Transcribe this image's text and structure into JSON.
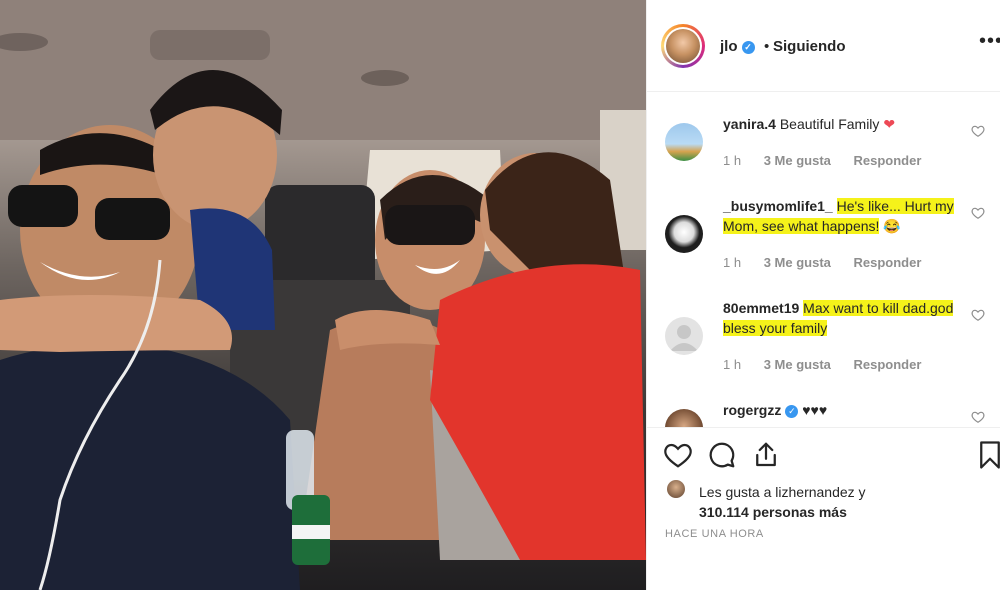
{
  "post": {
    "username": "jlo",
    "verified": true,
    "separator": "•",
    "follow_status": "Siguiendo",
    "more_icon": "more-options-icon"
  },
  "comments": [
    {
      "username": "yanira.4",
      "text": "Beautiful Family",
      "emoji": "❤",
      "highlight": false,
      "time": "1 h",
      "likes": "3 Me gusta",
      "reply": "Responder"
    },
    {
      "username": "_busymomlife1_",
      "text_highlight": "He's like... Hurt my Mom, see what happens!",
      "emoji": "😂",
      "time": "1 h",
      "likes": "3 Me gusta",
      "reply": "Responder"
    },
    {
      "username": "80emmet19",
      "text_highlight": "Max want to kill dad.god bless your family",
      "time": "1 h",
      "likes": "3 Me gusta",
      "reply": "Responder"
    },
    {
      "username": "rogergzz",
      "verified": true,
      "text": "♥♥♥"
    }
  ],
  "actions": {
    "like_icon": "heart-icon",
    "comment_icon": "comment-icon",
    "share_icon": "share-icon",
    "save_icon": "bookmark-icon"
  },
  "likes": {
    "line1": "Les gusta a lizhernandez y",
    "line2": "310.114 personas más"
  },
  "timestamp": "HACE UNA HORA",
  "colors": {
    "highlight": "#f5f21a",
    "verified": "#3897f0",
    "heart": "#ed4956"
  }
}
